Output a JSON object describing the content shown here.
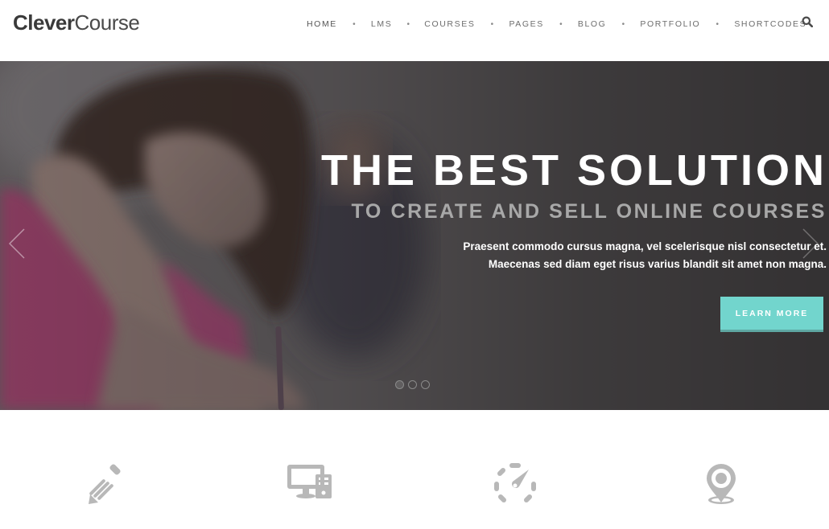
{
  "header": {
    "logo": {
      "bold": "Clever",
      "light": "Course"
    },
    "nav": [
      {
        "label": "HOME",
        "active": true
      },
      {
        "label": "LMS"
      },
      {
        "label": "COURSES"
      },
      {
        "label": "PAGES"
      },
      {
        "label": "BLOG"
      },
      {
        "label": "PORTFOLIO"
      },
      {
        "label": "SHORTCODES"
      }
    ],
    "separator": "•",
    "search_icon": "search-icon"
  },
  "hero": {
    "title": "THE BEST SOLUTION",
    "subtitle": "TO CREATE AND SELL ONLINE COURSES",
    "text_line1": "Praesent commodo cursus magna, vel scelerisque nisl consectetur et.",
    "text_line2": "Maecenas sed diam eget risus varius blandit sit amet non magna.",
    "button_label": "LEARN MORE",
    "button_color": "#72d5cd",
    "prev_icon": "chevron-left-icon",
    "next_icon": "chevron-right-icon",
    "slides_total": 3,
    "active_slide": 1
  },
  "features": {
    "icons": [
      "pencil-icon",
      "desktop-computer-icon",
      "speedometer-icon",
      "map-pin-icon"
    ],
    "icon_color": "#b5b5b5"
  }
}
